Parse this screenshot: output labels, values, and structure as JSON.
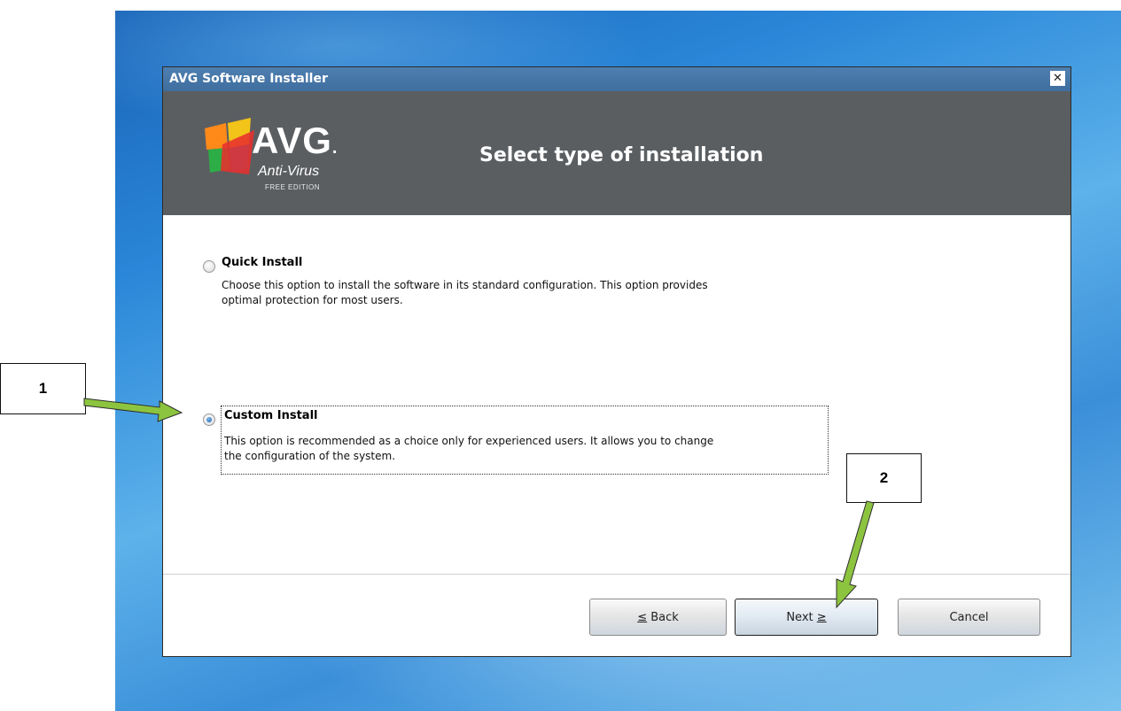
{
  "window": {
    "title": "AVG Software Installer",
    "close_glyph": "✕"
  },
  "banner": {
    "logo_text": "AVG",
    "logo_dot": ".",
    "product": "Anti-Virus",
    "edition": "FREE EDITION",
    "heading": "Select type of installation"
  },
  "options": {
    "quick": {
      "title": "Quick Install",
      "description_line1": "Choose this option to install the software in its standard configuration. This option provides",
      "description_line2": "optimal protection for most users.",
      "selected": false
    },
    "custom": {
      "title": "Custom Install",
      "description_line1": "This option is recommended as a choice only for experienced users. It allows you to change",
      "description_line2": "the configuration of the system.",
      "selected": true
    }
  },
  "buttons": {
    "back_prefix": "≤",
    "back_label": " Back",
    "next_label": "Next ",
    "next_suffix": "≥",
    "cancel_label": "Cancel"
  },
  "annotations": {
    "callout1": "1",
    "callout2": "2",
    "arrow_color": "#8cc43f"
  }
}
